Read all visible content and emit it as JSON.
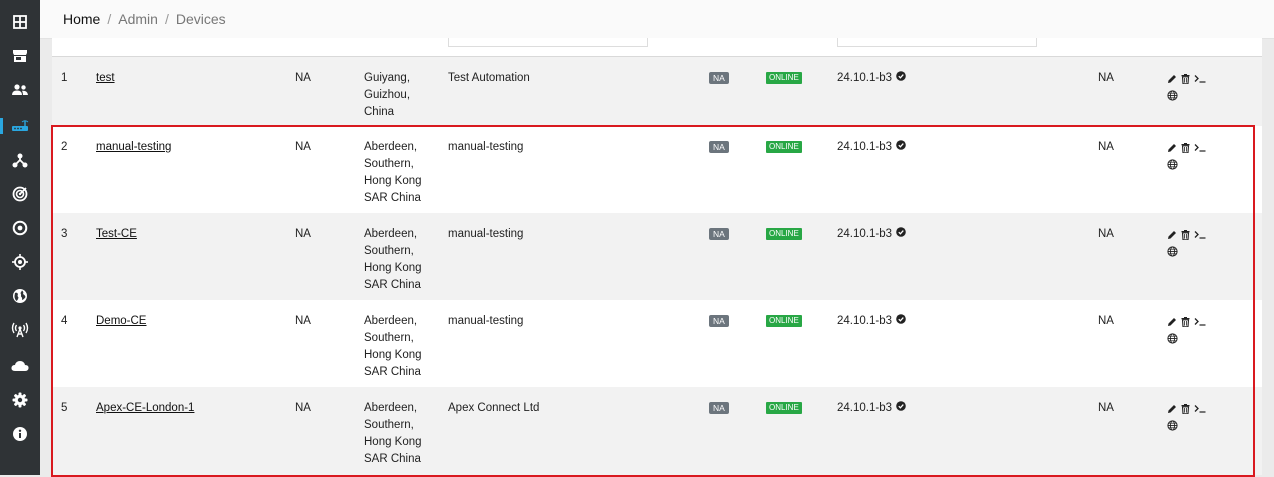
{
  "sidebar": {
    "items": [
      {
        "icon": "dashboard-grid-icon"
      },
      {
        "icon": "store-icon"
      },
      {
        "icon": "users-icon"
      },
      {
        "icon": "router-icon",
        "active": true
      },
      {
        "icon": "network-hierarchy-icon"
      },
      {
        "icon": "radar-icon"
      },
      {
        "icon": "target-circle-icon"
      },
      {
        "icon": "crosshair-location-icon"
      },
      {
        "icon": "globe-icon"
      },
      {
        "icon": "wireless-tower-icon"
      },
      {
        "icon": "cloud-icon"
      },
      {
        "icon": "gear-icon"
      },
      {
        "icon": "info-icon"
      }
    ]
  },
  "breadcrumb": {
    "home": "Home",
    "admin": "Admin",
    "current": "Devices",
    "separator": "/"
  },
  "colors": {
    "accent": "#2aa7e0",
    "online": "#28a745",
    "na_badge": "#6c757d",
    "highlight": "#d9191f"
  },
  "devices": [
    {
      "num": "1",
      "name": "test",
      "na1": "NA",
      "location": [
        "Guiyang,",
        "Guizhou,",
        "China"
      ],
      "customer": "Test Automation",
      "badge_na": "NA",
      "status": "ONLINE",
      "version": "24.10.1-b3",
      "na2": "NA"
    },
    {
      "num": "2",
      "name": "manual-testing",
      "na1": "NA",
      "location": [
        "Aberdeen,",
        "Southern,",
        "Hong Kong",
        "SAR China"
      ],
      "customer": "manual-testing",
      "badge_na": "NA",
      "status": "ONLINE",
      "version": "24.10.1-b3",
      "na2": "NA"
    },
    {
      "num": "3",
      "name": "Test-CE",
      "na1": "NA",
      "location": [
        "Aberdeen,",
        "Southern,",
        "Hong Kong",
        "SAR China"
      ],
      "customer": "manual-testing",
      "badge_na": "NA",
      "status": "ONLINE",
      "version": "24.10.1-b3",
      "na2": "NA"
    },
    {
      "num": "4",
      "name": "Demo-CE",
      "na1": "NA",
      "location": [
        "Aberdeen,",
        "Southern,",
        "Hong Kong",
        "SAR China"
      ],
      "customer": "manual-testing",
      "badge_na": "NA",
      "status": "ONLINE",
      "version": "24.10.1-b3",
      "na2": "NA"
    },
    {
      "num": "5",
      "name": "Apex-CE-London-1",
      "na1": "NA",
      "location": [
        "Aberdeen,",
        "Southern,",
        "Hong Kong",
        "SAR China"
      ],
      "customer": "Apex Connect Ltd",
      "badge_na": "NA",
      "status": "ONLINE",
      "version": "24.10.1-b3",
      "na2": "NA"
    }
  ]
}
